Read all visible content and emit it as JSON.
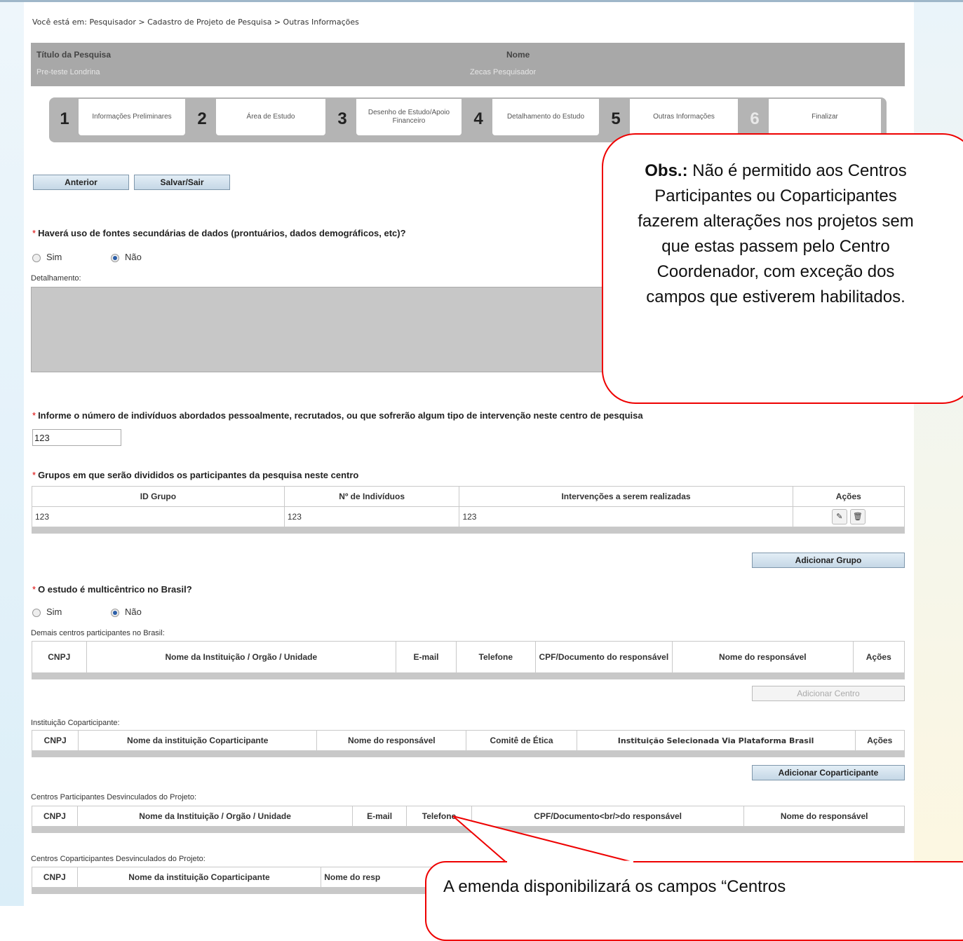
{
  "breadcrumb": "Você está em: Pesquisador > Cadastro de Projeto de Pesquisa > Outras Informações",
  "project": {
    "title_label": "Título da Pesquisa",
    "title_value": "Pre-teste Londrina",
    "name_label": "Nome",
    "name_value": "Zecas Pesquisador"
  },
  "steps": [
    {
      "num": "1",
      "label": "Informações Preliminares"
    },
    {
      "num": "2",
      "label": "Área de Estudo"
    },
    {
      "num": "3",
      "label": "Desenho de Estudo/Apoio Financeiro"
    },
    {
      "num": "4",
      "label": "Detalhamento do Estudo"
    },
    {
      "num": "5",
      "label": "Outras Informações"
    },
    {
      "num": "6",
      "label": "Finalizar"
    }
  ],
  "buttons": {
    "previous": "Anterior",
    "save_exit": "Salvar/Sair",
    "add_group": "Adicionar Grupo",
    "add_center": "Adicionar Centro",
    "add_coparticipant": "Adicionar Coparticipante"
  },
  "q1": {
    "star": "*",
    "text": "Haverá uso de fontes secundárias de dados (prontuários, dados demográficos, etc)?",
    "opt_yes": "Sim",
    "opt_no": "Não",
    "selected": "Não",
    "detail_label": "Detalhamento:"
  },
  "q2": {
    "star": "*",
    "text": "Informe o número de indivíduos abordados pessoalmente, recrutados, ou que sofrerão algum tipo de intervenção neste centro de pesquisa",
    "value": "123"
  },
  "q3": {
    "star": "*",
    "text": "Grupos em que serão divididos os participantes da pesquisa neste centro",
    "headers": [
      "ID Grupo",
      "Nº de Indivíduos",
      "Intervenções a serem realizadas",
      "Ações"
    ],
    "rows": [
      [
        "123",
        "123",
        "123"
      ]
    ]
  },
  "q4": {
    "star": "*",
    "text": "O estudo é multicêntrico no Brasil?",
    "opt_yes": "Sim",
    "opt_no": "Não",
    "selected": "Não"
  },
  "centers": {
    "label": "Demais centros participantes no Brasil:",
    "headers": [
      "CNPJ",
      "Nome da Instituição / Orgão / Unidade",
      "E-mail",
      "Telefone",
      "CPF/Documento do responsável",
      "Nome do responsável",
      "Ações"
    ]
  },
  "coparticipant": {
    "label": "Instituição Coparticipante:",
    "headers": [
      "CNPJ",
      "Nome da instituição Coparticipante",
      "Nome do responsável",
      "Comitê de Ética",
      "Instituição Selecionada Via Plataforma Brasil",
      "Ações"
    ]
  },
  "unlinked_centers": {
    "label": "Centros Participantes Desvinculados do Projeto:",
    "headers": [
      "CNPJ",
      "Nome da Instituição / Orgão / Unidade",
      "E-mail",
      "Telefone",
      "CPF/Documento<br/>do responsável",
      "Nome do responsável"
    ]
  },
  "unlinked_coparticipants": {
    "label": "Centros Coparticipantes Desvinculados do Projeto:",
    "headers": [
      "CNPJ",
      "Nome da instituição Coparticipante",
      "Nome do resp"
    ]
  },
  "callouts": {
    "obs_bold": "Obs.:",
    "obs_text": " Não é permitido aos Centros Participantes ou Coparticipantes fazerem alterações nos projetos sem que estas passem pelo Centro Coordenador, com exceção dos campos que estiverem habilitados.",
    "emenda_text": "A emenda disponibilizará os campos “Centros"
  },
  "colors": {
    "accent_red": "#e00000",
    "header_gray": "#a8a8a8",
    "button_blue": "#c5d7e6"
  },
  "icons": [
    "pencil-icon",
    "trash-icon"
  ]
}
